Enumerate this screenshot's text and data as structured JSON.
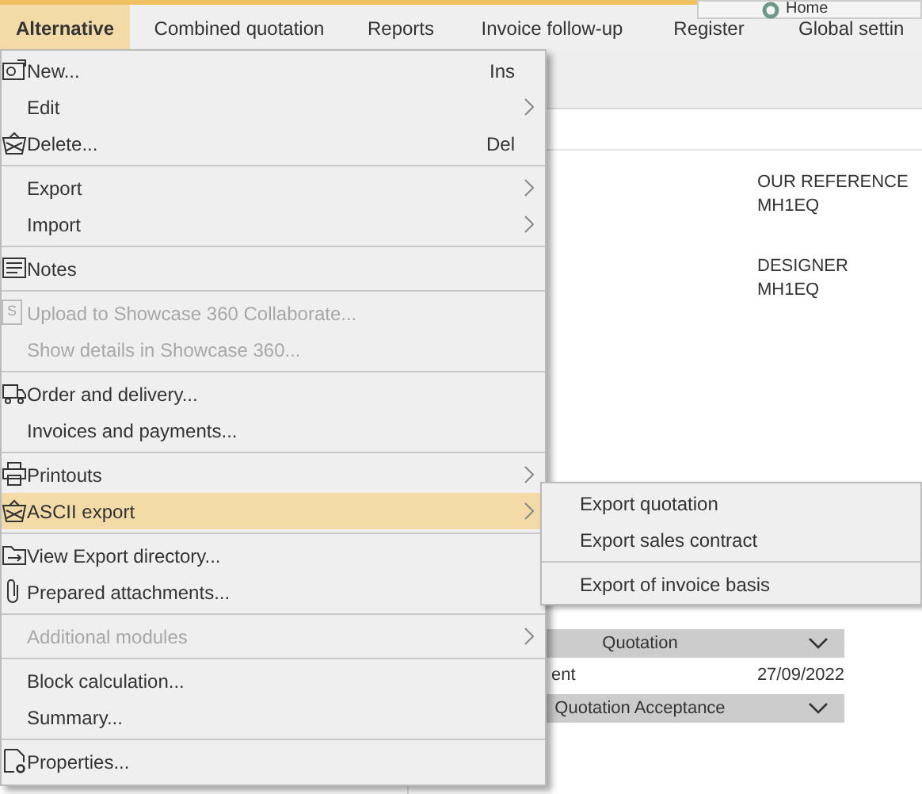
{
  "menubar": [
    {
      "label": "Alternative",
      "selected": true
    },
    {
      "label": "Combined quotation",
      "selected": false
    },
    {
      "label": "Reports",
      "selected": false
    },
    {
      "label": "Invoice follow-up",
      "selected": false
    },
    {
      "label": "Register",
      "selected": false
    },
    {
      "label": "Global settin",
      "selected": false
    }
  ],
  "home_popup": {
    "label": "Home"
  },
  "background": {
    "fields": [
      {
        "label": "OUR REFERENCE",
        "value": "MH1EQ"
      },
      {
        "label": "DESIGNER",
        "value": "MH1EQ"
      }
    ],
    "sections": [
      {
        "title": "Quotation",
        "rows": [
          {
            "label": "ent",
            "value": "27/09/2022"
          }
        ]
      },
      {
        "title": "Quotation Acceptance"
      }
    ]
  },
  "menu": [
    {
      "kind": "item",
      "label": "New...",
      "shortcut": "Ins",
      "submenu": false,
      "disabled": false,
      "selected": false
    },
    {
      "kind": "item",
      "label": "Edit",
      "submenu": true,
      "disabled": false,
      "selected": false
    },
    {
      "kind": "item",
      "label": "Delete...",
      "shortcut": "Del",
      "submenu": false,
      "disabled": false,
      "selected": false
    },
    {
      "kind": "separator"
    },
    {
      "kind": "item",
      "label": "Export",
      "submenu": true,
      "disabled": false,
      "selected": false
    },
    {
      "kind": "item",
      "label": "Import",
      "submenu": true,
      "disabled": false,
      "selected": false
    },
    {
      "kind": "separator"
    },
    {
      "kind": "item",
      "label": "Notes",
      "submenu": false,
      "disabled": false,
      "selected": false
    },
    {
      "kind": "separator"
    },
    {
      "kind": "item",
      "label": "Upload to Showcase 360 Collaborate...",
      "icon_letter": "S",
      "submenu": false,
      "disabled": true,
      "selected": false
    },
    {
      "kind": "item",
      "label": "Show details in Showcase 360...",
      "submenu": false,
      "disabled": true,
      "selected": false
    },
    {
      "kind": "separator"
    },
    {
      "kind": "item",
      "label": "Order and delivery...",
      "submenu": false,
      "disabled": false,
      "selected": false
    },
    {
      "kind": "item",
      "label": "Invoices and payments...",
      "submenu": false,
      "disabled": false,
      "selected": false
    },
    {
      "kind": "separator"
    },
    {
      "kind": "item",
      "label": "Printouts",
      "submenu": true,
      "disabled": false,
      "selected": false
    },
    {
      "kind": "item",
      "label": "ASCII export",
      "submenu": true,
      "disabled": false,
      "selected": true
    },
    {
      "kind": "separator"
    },
    {
      "kind": "item",
      "label": "View Export directory...",
      "submenu": false,
      "disabled": false,
      "selected": false
    },
    {
      "kind": "item",
      "label": "Prepared attachments...",
      "submenu": false,
      "disabled": false,
      "selected": false
    },
    {
      "kind": "separator"
    },
    {
      "kind": "item",
      "label": "Additional modules",
      "submenu": true,
      "disabled": true,
      "selected": false
    },
    {
      "kind": "separator"
    },
    {
      "kind": "item",
      "label": "Block calculation...",
      "submenu": false,
      "disabled": false,
      "selected": false
    },
    {
      "kind": "item",
      "label": "Summary...",
      "submenu": false,
      "disabled": false,
      "selected": false
    },
    {
      "kind": "separator"
    },
    {
      "kind": "item",
      "label": "Properties...",
      "submenu": false,
      "disabled": false,
      "selected": false
    }
  ],
  "submenu": [
    {
      "kind": "item",
      "label": "Export quotation"
    },
    {
      "kind": "item",
      "label": "Export sales contract"
    },
    {
      "kind": "separator"
    },
    {
      "kind": "item",
      "label": "Export of invoice basis"
    }
  ]
}
